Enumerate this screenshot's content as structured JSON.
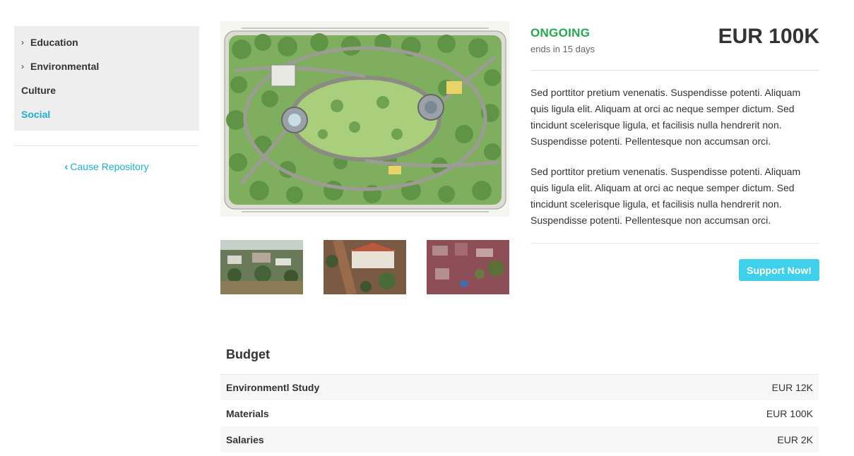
{
  "sidebar": {
    "categories": [
      {
        "label": "Education",
        "expandable": true,
        "active": false
      },
      {
        "label": "Environmental",
        "expandable": true,
        "active": false
      },
      {
        "label": "Culture",
        "expandable": false,
        "active": false
      },
      {
        "label": "Social",
        "expandable": false,
        "active": true
      }
    ],
    "repository_link": "Cause Repository"
  },
  "cause": {
    "status": "ONGOING",
    "ends": "ends in 15 days",
    "amount": "EUR 100K",
    "paragraphs": [
      "Sed porttitor pretium venenatis. Suspendisse potenti. Aliquam quis ligula elit. Aliquam at orci ac neque semper dictum. Sed tincidunt scelerisque ligula, et facilisis nulla hendrerit non. Suspendisse potenti. Pellentesque non accumsan orci.",
      "Sed porttitor pretium venenatis. Suspendisse potenti. Aliquam quis ligula elit. Aliquam at orci ac neque semper dictum. Sed tincidunt scelerisque ligula, et facilisis nulla hendrerit non. Suspendisse potenti. Pellentesque non accumsan orci."
    ],
    "support_label": "Support Now!"
  },
  "budget": {
    "title": "Budget",
    "rows": [
      {
        "name": "Environmentl Study",
        "value": "EUR 12K"
      },
      {
        "name": "Materials",
        "value": "EUR 100K"
      },
      {
        "name": "Salaries",
        "value": "EUR 2K"
      }
    ]
  },
  "colors": {
    "accent": "#1ab1d8",
    "status_green": "#23a94f",
    "button": "#3fd0ec"
  },
  "icons": {
    "expand": "chevron-right-icon",
    "back": "chevron-left-icon"
  }
}
